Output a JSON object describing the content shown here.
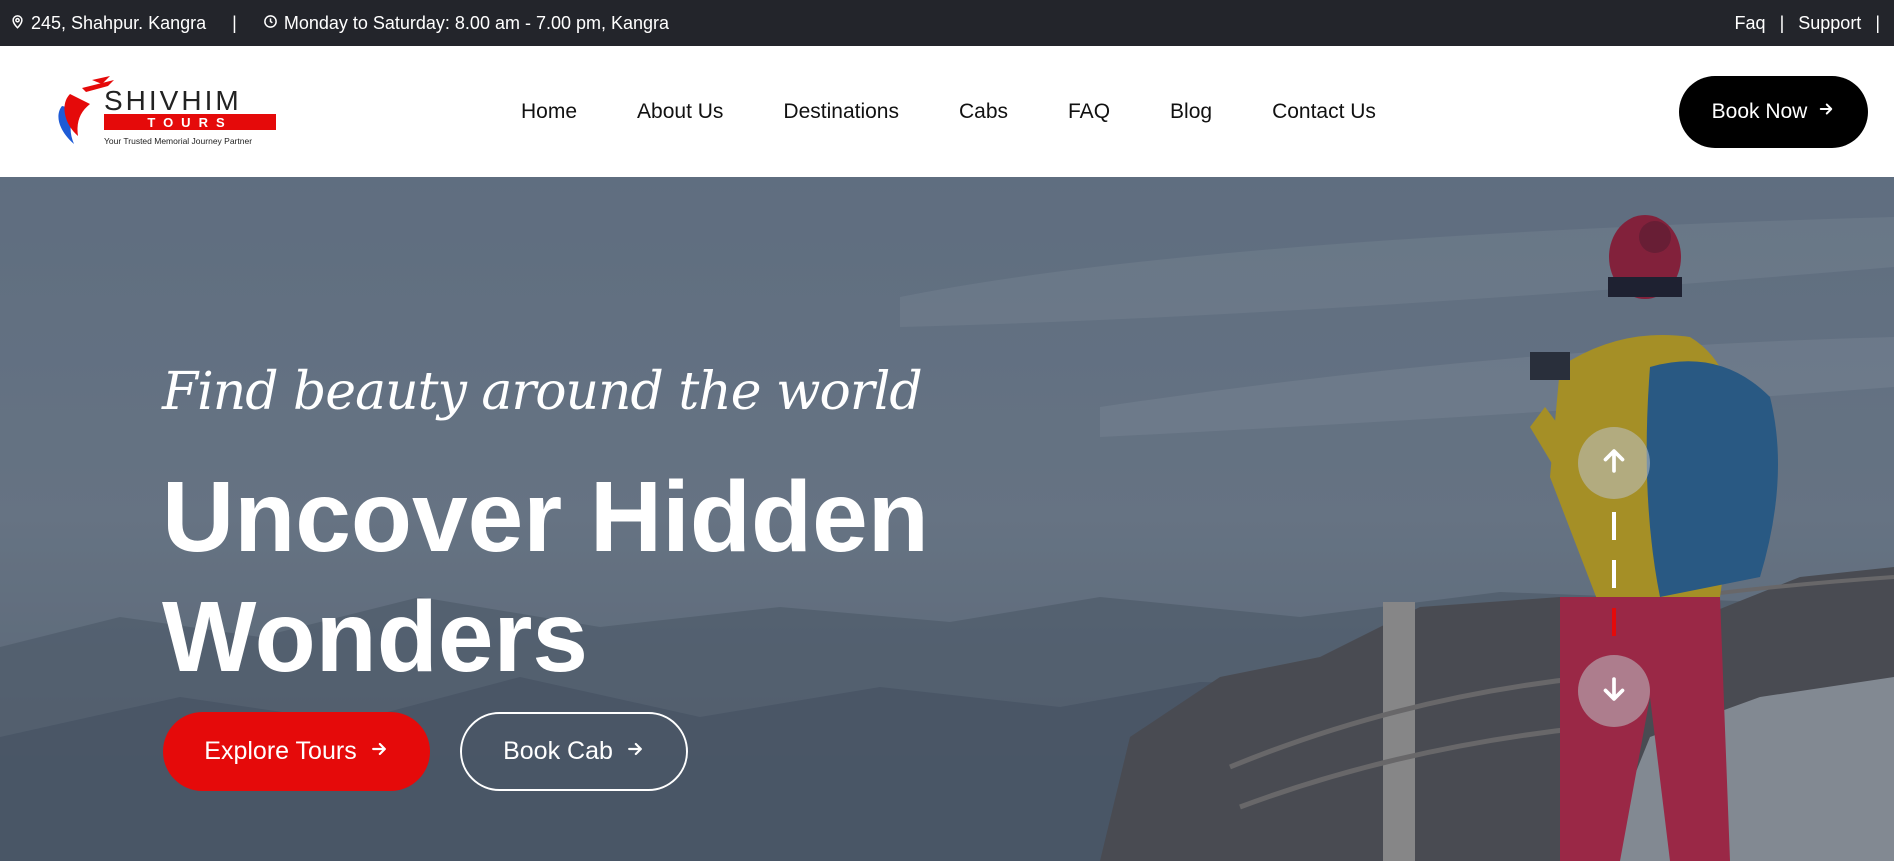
{
  "topbar": {
    "address": "245, Shahpur. Kangra",
    "separator": "|",
    "hours": "Monday to Saturday: 8.00 am - 7.00 pm, Kangra",
    "links": [
      {
        "label": "Faq"
      },
      {
        "label": "Support"
      }
    ]
  },
  "brand": {
    "name": "SHIVHIM",
    "sub": "TOURS",
    "tagline": "Your Trusted Memorial Journey Partner",
    "accent": "#e50a0a"
  },
  "nav": {
    "items": [
      {
        "label": "Home"
      },
      {
        "label": "About Us"
      },
      {
        "label": "Destinations"
      },
      {
        "label": "Cabs"
      },
      {
        "label": "FAQ"
      },
      {
        "label": "Blog"
      },
      {
        "label": "Contact Us"
      }
    ],
    "cta": "Book Now"
  },
  "hero": {
    "tagline": "Find beauty around the world",
    "headline_line1": "Uncover Hidden",
    "headline_line2": "Wonders",
    "primary_button": "Explore Tours",
    "secondary_button": "Book Cab"
  },
  "icons": {
    "address": "map-pin-icon",
    "hours": "clock-icon",
    "arrow": "arrow-right-icon",
    "slider_up": "arrow-up-icon",
    "slider_down": "arrow-down-icon"
  },
  "colors": {
    "topbar_bg": "#23252b",
    "primary": "#e50a0a",
    "dark_button": "#000000"
  }
}
